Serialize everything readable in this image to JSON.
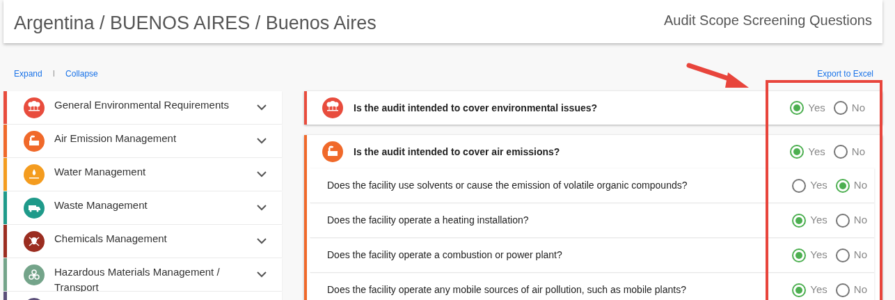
{
  "header": {
    "title": "Argentina / BUENOS AIRES / Buenos Aires",
    "subtitle": "Audit Scope Screening Questions"
  },
  "toolbar": {
    "expand": "Expand",
    "separator": "I",
    "collapse": "Collapse",
    "export": "Export to Excel"
  },
  "sidebar": {
    "items": [
      {
        "label": "General Environmental Requirements",
        "color": "#e84c3d"
      },
      {
        "label": "Air Emission Management",
        "color": "#f0692a"
      },
      {
        "label": "Water Management",
        "color": "#f49c1f"
      },
      {
        "label": "Waste Management",
        "color": "#1f9a8a"
      },
      {
        "label": "Chemicals Management",
        "color": "#9b2d20"
      },
      {
        "label": "Hazardous Materials Management / Transport",
        "color": "#74a48a"
      },
      {
        "color": "#5b4f79"
      }
    ]
  },
  "questions": [
    {
      "text": "Is the audit intended to cover environmental issues?",
      "color": "#e84c3d",
      "options": [
        {
          "label": "Yes",
          "selected": true
        },
        {
          "label": "No",
          "selected": false
        }
      ]
    },
    {
      "text": "Is the audit intended to cover air emissions?",
      "color": "#f0692a",
      "options": [
        {
          "label": "Yes",
          "selected": true
        },
        {
          "label": "No",
          "selected": false
        }
      ],
      "sub_questions": [
        {
          "text": "Does the facility use solvents or cause the emission of volatile organic compounds?",
          "options": [
            {
              "label": "Yes",
              "selected": false
            },
            {
              "label": "No",
              "selected": true
            }
          ]
        },
        {
          "text": "Does the facility operate a heating installation?",
          "options": [
            {
              "label": "Yes",
              "selected": true
            },
            {
              "label": "No",
              "selected": false
            }
          ]
        },
        {
          "text": "Does the facility operate a combustion or power plant?",
          "options": [
            {
              "label": "Yes",
              "selected": true
            },
            {
              "label": "No",
              "selected": false
            }
          ]
        },
        {
          "text": "Does the facility operate any mobile sources of air pollution, such as mobile plants?",
          "options": [
            {
              "label": "Yes",
              "selected": true
            },
            {
              "label": "No",
              "selected": false
            }
          ]
        }
      ]
    }
  ]
}
